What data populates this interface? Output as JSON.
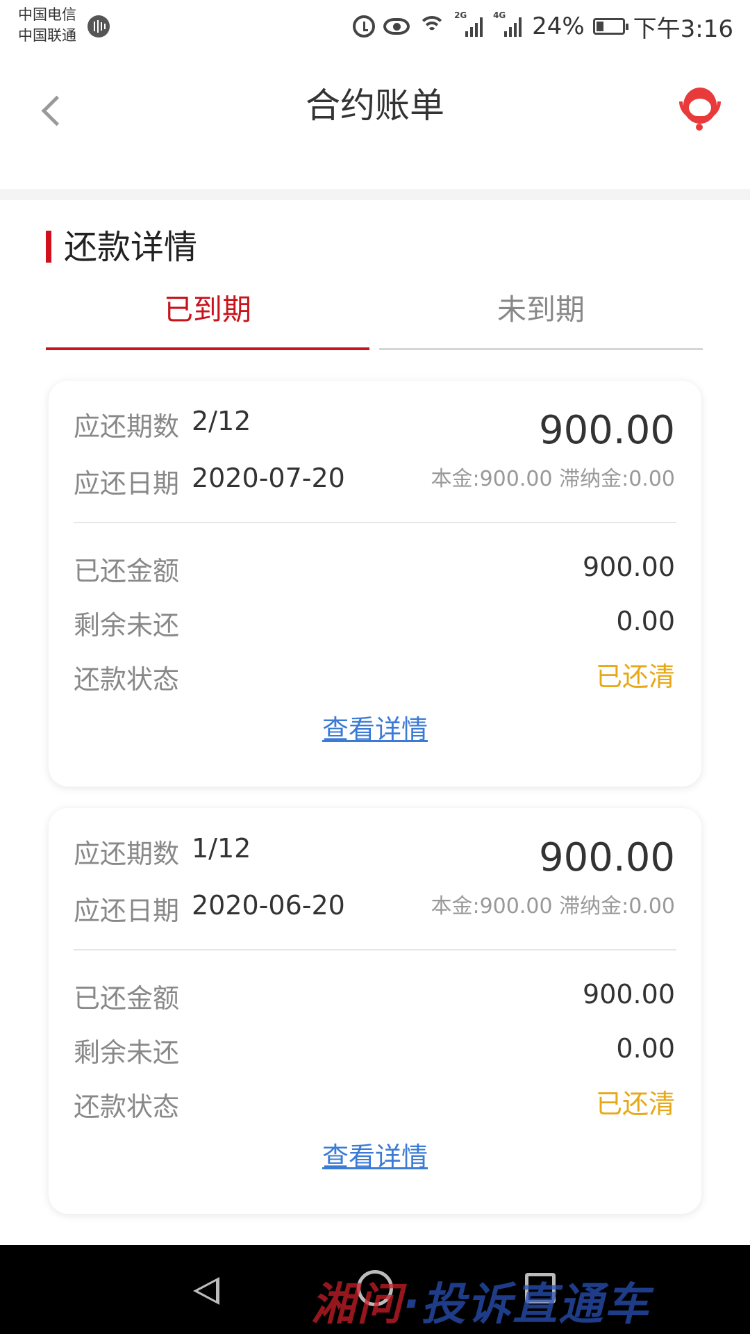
{
  "status_bar": {
    "carrier1": "中国电信",
    "carrier2": "中国联通",
    "signal1_tag": "2G",
    "signal2_tag": "4G",
    "battery": "24%",
    "time": "下午3:16"
  },
  "header": {
    "title": "合约账单"
  },
  "section": {
    "title": "还款详情"
  },
  "tabs": [
    {
      "label": "已到期",
      "active": true
    },
    {
      "label": "未到期",
      "active": false
    }
  ],
  "labels": {
    "period": "应还期数",
    "due_date": "应还日期",
    "paid": "已还金额",
    "remaining": "剩余未还",
    "status": "还款状态",
    "view_detail": "查看详情"
  },
  "bills": [
    {
      "period": "2/12",
      "due_date": "2020-07-20",
      "amount": "900.00",
      "breakdown": "本金:900.00 滞纳金:0.00",
      "paid": "900.00",
      "remaining": "0.00",
      "status": "已还清"
    },
    {
      "period": "1/12",
      "due_date": "2020-06-20",
      "amount": "900.00",
      "breakdown": "本金:900.00 滞纳金:0.00",
      "paid": "900.00",
      "remaining": "0.00",
      "status": "已还清"
    }
  ],
  "watermark": {
    "part1": "湘问",
    "part2": "·投诉直通车"
  },
  "colors": {
    "accent": "#c8141c",
    "status_paid": "#e6a817",
    "link": "#3b7bd6"
  }
}
